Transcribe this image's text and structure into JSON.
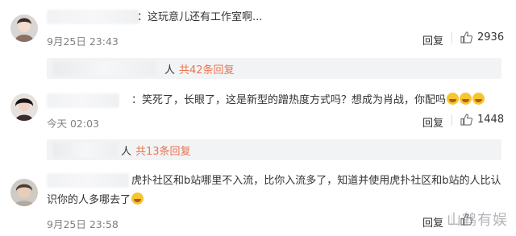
{
  "comments": [
    {
      "text": "：这玩意儿还有工作室啊...",
      "time": "9月25日 23:43",
      "reply": "回复",
      "likes": "2936"
    },
    {
      "text": "：笑死了，长眼了，这是新型的蹭热度方式吗？想成为肖战，你配吗",
      "time": "今天 02:03",
      "reply": "回复",
      "likes": "1448"
    },
    {
      "text_line1": "虎扑社区和b站哪里不入流，比你入流多了，知道并使用虎扑社区和b站的人比认",
      "text_line2": "识你的人多哪去了",
      "time": "9月25日 23:58",
      "reply": "回复"
    }
  ],
  "replies": [
    {
      "ren": "人",
      "count": "共42条回复"
    },
    {
      "ren": "人",
      "count": "共13条回复"
    }
  ],
  "watermark": "山鹤有娱"
}
